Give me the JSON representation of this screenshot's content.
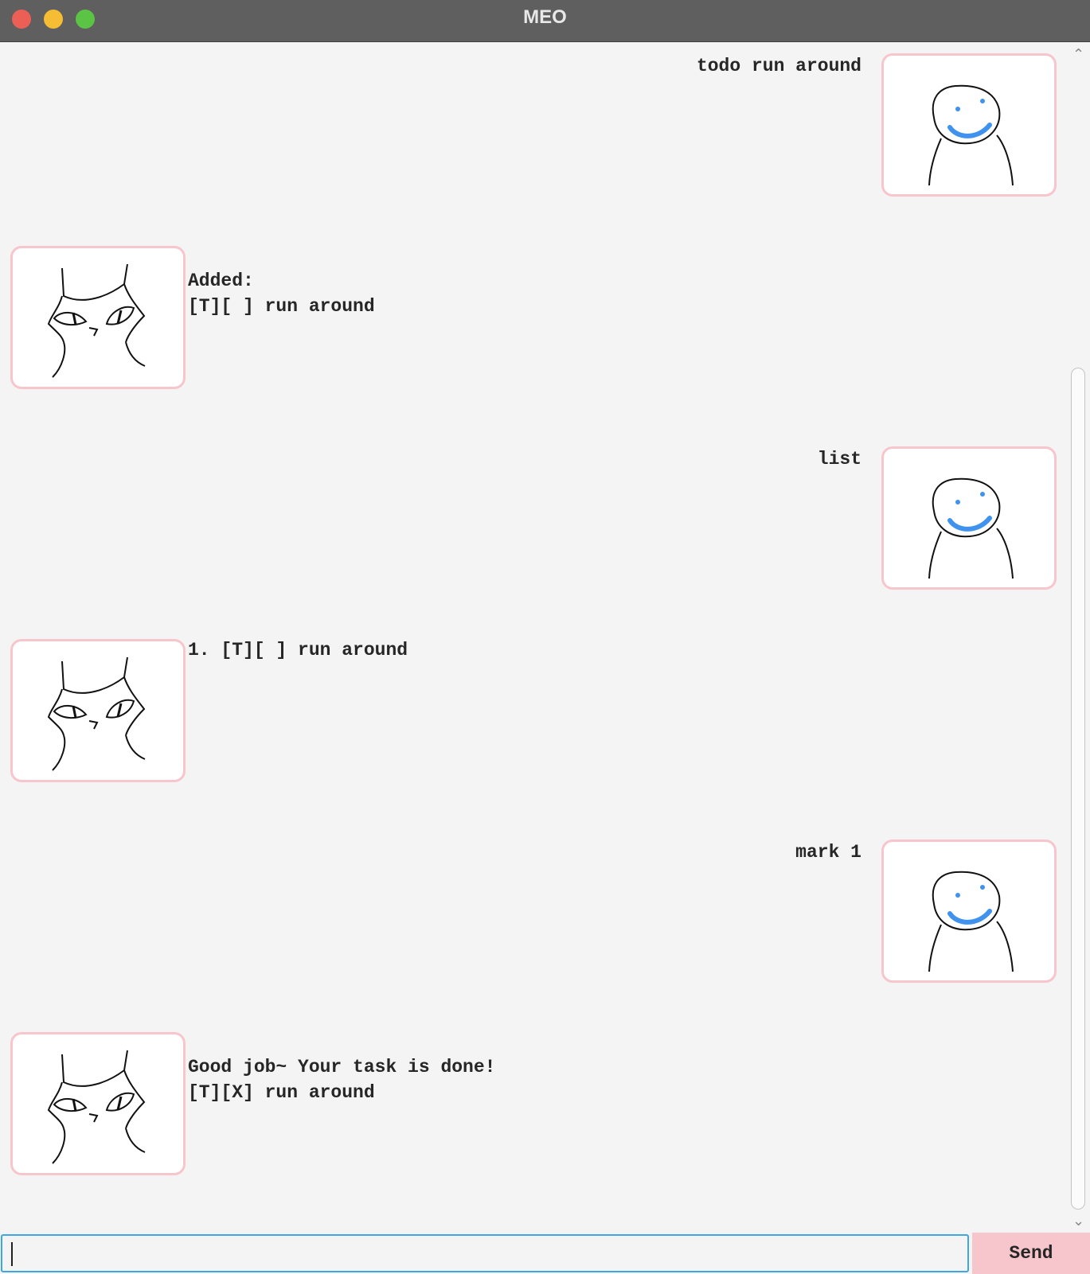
{
  "window": {
    "title": "MEO"
  },
  "messages": [
    {
      "sender": "user",
      "lines": [
        "todo run around"
      ]
    },
    {
      "sender": "bot",
      "lines": [
        "Added:",
        "[T][ ] run around"
      ]
    },
    {
      "sender": "user",
      "lines": [
        "list"
      ]
    },
    {
      "sender": "bot",
      "lines": [
        "1. [T][ ] run around"
      ]
    },
    {
      "sender": "user",
      "lines": [
        "mark 1"
      ]
    },
    {
      "sender": "bot",
      "lines": [
        "Good job~ Your task is done!",
        "[T][X] run around"
      ]
    }
  ],
  "input": {
    "value": "",
    "placeholder": ""
  },
  "send_button": {
    "label": "Send"
  },
  "icons": {
    "user_avatar": "smiley-person-icon",
    "bot_avatar": "cat-face-icon"
  },
  "colors": {
    "avatar_border": "#f7c5cc",
    "send_button": "#f7c5cc",
    "input_focus": "#3ea6e0",
    "smile": "#3f93ee"
  }
}
